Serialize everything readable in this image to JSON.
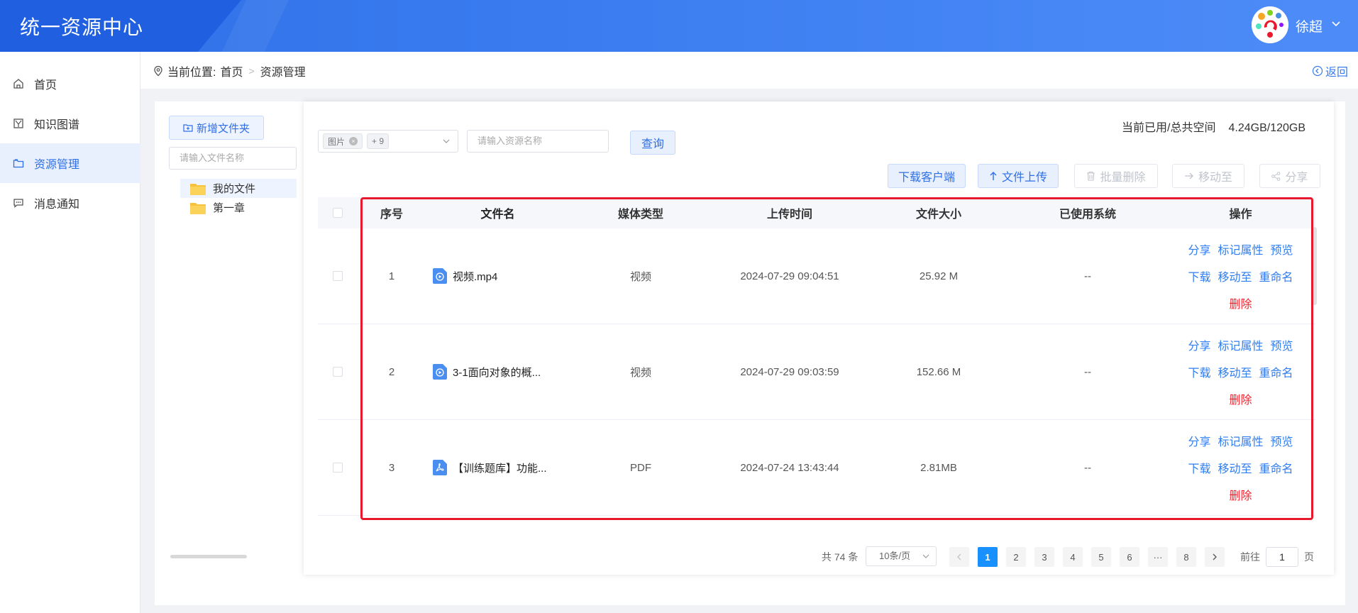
{
  "header": {
    "app_title": "统一资源中心",
    "user_name": "徐超"
  },
  "sidebar": {
    "items": [
      {
        "label": "首页",
        "icon": "home-icon"
      },
      {
        "label": "知识图谱",
        "icon": "graph-icon"
      },
      {
        "label": "资源管理",
        "icon": "folder-icon",
        "active": true
      },
      {
        "label": "消息通知",
        "icon": "message-icon"
      }
    ]
  },
  "breadcrumb": {
    "prefix": "当前位置:",
    "items": [
      "首页",
      "资源管理"
    ],
    "back_label": "返回"
  },
  "folders": {
    "new_folder_label": "新增文件夹",
    "search_placeholder": "请输入文件名称",
    "tree": [
      {
        "label": "我的文件",
        "active": true
      },
      {
        "label": "第一章"
      }
    ]
  },
  "filters": {
    "type_tag": "图片",
    "more_tag": "+ 9",
    "name_placeholder": "请输入资源名称",
    "query_label": "查询"
  },
  "storage": {
    "label": "当前已用/总共空间",
    "value": "4.24GB/120GB"
  },
  "toolbar": {
    "download_client": "下载客户端",
    "upload": "文件上传",
    "batch_delete": "批量删除",
    "move_to": "移动至",
    "share": "分享"
  },
  "table": {
    "headers": [
      "序号",
      "文件名",
      "媒体类型",
      "上传时间",
      "文件大小",
      "已使用系统",
      "操作"
    ],
    "rows": [
      {
        "index": "1",
        "name": "视频.mp4",
        "type": "视频",
        "time": "2024-07-29 09:04:51",
        "size": "25.92 M",
        "system": "--",
        "file_icon": "video-file-icon"
      },
      {
        "index": "2",
        "name": "3-1面向对象的概...",
        "type": "视频",
        "time": "2024-07-29 09:03:59",
        "size": "152.66 M",
        "system": "--",
        "file_icon": "video-file-icon"
      },
      {
        "index": "3",
        "name": "【训练题库】功能...",
        "type": "PDF",
        "time": "2024-07-24 13:43:44",
        "size": "2.81MB",
        "system": "--",
        "file_icon": "pdf-file-icon"
      }
    ],
    "ops": {
      "share": "分享",
      "mark": "标记属性",
      "preview": "预览",
      "download": "下载",
      "move": "移动至",
      "rename": "重命名",
      "delete": "删除"
    }
  },
  "pagination": {
    "total": "共 74 条",
    "page_size": "10条/页",
    "pages": [
      "1",
      "2",
      "3",
      "4",
      "5",
      "6",
      "···",
      "8"
    ],
    "current": "1",
    "goto_label": "前往",
    "goto_value": "1",
    "goto_suffix": "页"
  },
  "colors": {
    "header_blue": "#3a7cf0",
    "accent": "#2f6fe6",
    "link": "#2f7ef0",
    "danger": "#f5222d",
    "highlight_frame": "#e8192c"
  }
}
